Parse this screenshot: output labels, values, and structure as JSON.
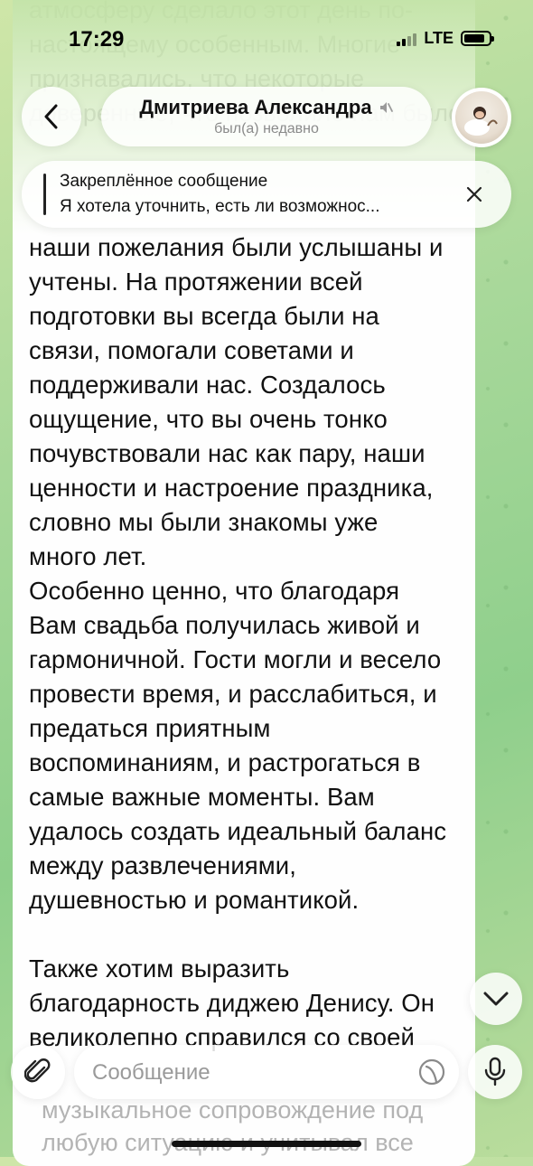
{
  "status_bar": {
    "time": "17:29",
    "network": "LTE",
    "battery_level": 0.85
  },
  "header": {
    "title": "Дмитриева Александра",
    "subtitle": "был(а) недавно",
    "muted_icon": "speaker-muted-icon"
  },
  "pinned": {
    "title": "Закреплённое сообщение",
    "text": "Я хотела уточнить, есть ли возможнос..."
  },
  "message": {
    "ghost_top": "атмосферу сделало этот день по-\nнастоящему особенным. Многие\nпризнавались, что некоторые\nдоверенные, что позволило нам было",
    "text": "наши пожелания были услышаны и\nучтены. На протяжении всей\nподготовки вы всегда были на\nсвязи, помогали советами и\nподдерживали нас. Создалось\nощущение, что вы очень тонко\nпочувствовали нас как пару, наши\nценности и настроение праздника,\nсловно мы были знакомы уже\nмного лет.\nОсобенно ценно, что благодаря\nВам свадьба получилась живой и\nгармоничной. Гости могли и весело\nпровести время, и расслабиться, и\nпредаться приятным\nвоспоминаниям, и растрогаться в\nсамые важные моменты. Вам\nудалось создать идеальный баланс\nмежду развлечениями,\nдушевностью и романтикой.\n\nТакже хотим выразить\nблагодарность диджею Денису. Он\nвеликолепно справился со своей",
    "ghost_bottom": "музыкальное сопровождение под\nлюбую ситуацию и учитывал все"
  },
  "composer": {
    "placeholder": "Сообщение"
  }
}
